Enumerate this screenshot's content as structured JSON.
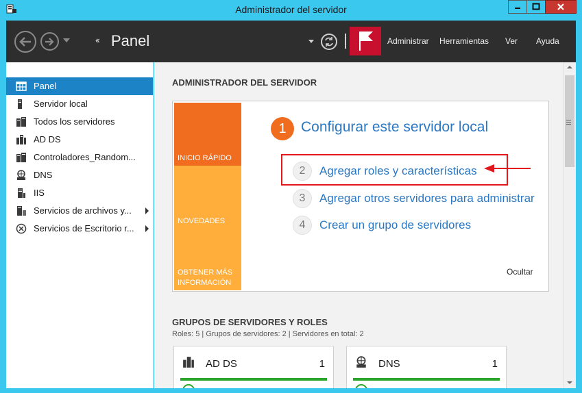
{
  "window": {
    "title": "Administrador del servidor",
    "buttons": [
      "minimize",
      "maximize",
      "close"
    ]
  },
  "header": {
    "breadcrumb_arrows": "‹‹",
    "breadcrumb_title": "Panel",
    "menu": [
      {
        "label": "Administrar"
      },
      {
        "label": "Herramientas"
      },
      {
        "label": "Ver"
      },
      {
        "label": "Ayuda"
      }
    ],
    "flag_color": "#c8102e"
  },
  "sidebar": {
    "items": [
      {
        "label": "Panel",
        "icon": "dashboard-icon",
        "selected": true
      },
      {
        "label": "Servidor local",
        "icon": "server-icon"
      },
      {
        "label": "Todos los servidores",
        "icon": "servers-icon"
      },
      {
        "label": "AD DS",
        "icon": "ad-ds-icon"
      },
      {
        "label": "Controladores_Random...",
        "icon": "controllers-icon"
      },
      {
        "label": "DNS",
        "icon": "dns-icon"
      },
      {
        "label": "IIS",
        "icon": "iis-icon"
      },
      {
        "label": "Servicios de archivos y...",
        "icon": "file-services-icon",
        "expandable": true
      },
      {
        "label": "Servicios de Escritorio r...",
        "icon": "remote-desktop-icon",
        "expandable": true
      }
    ]
  },
  "main": {
    "section_title": "ADMINISTRADOR DEL SERVIDOR",
    "tiles": [
      "INICIO RÁPIDO",
      "NOVEDADES",
      "OBTENER MÁS INFORMACIÓN"
    ],
    "steps": [
      {
        "number": "1",
        "label": "Configurar este servidor local"
      },
      {
        "number": "2",
        "label": "Agregar roles y características"
      },
      {
        "number": "3",
        "label": "Agregar otros servidores para administrar"
      },
      {
        "number": "4",
        "label": "Crear un grupo de servidores"
      }
    ],
    "hide_label": "Ocultar",
    "groups_title": "GRUPOS DE SERVIDORES Y ROLES",
    "groups_summary": "Roles: 5   |   Grupos de servidores: 2   |   Servidores en total: 2",
    "cards": [
      {
        "name": "AD DS",
        "count": "1",
        "icon": "ad-ds-icon"
      },
      {
        "name": "DNS",
        "count": "1",
        "icon": "dns-icon"
      }
    ],
    "annotation_color": "#e3181f"
  }
}
